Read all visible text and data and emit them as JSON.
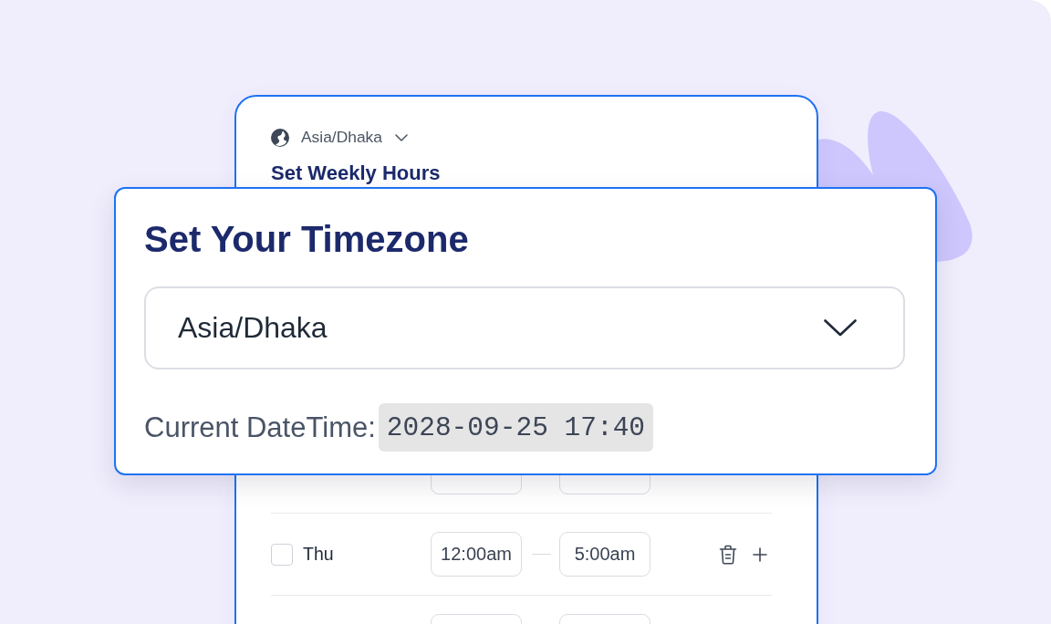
{
  "weekly_hours_card": {
    "timezone_selector": {
      "value": "Asia/Dhaka"
    },
    "heading": "Set Weekly Hours",
    "rows": [
      {},
      {
        "day": "Thu",
        "checked": false,
        "start": "12:00am",
        "end": "5:00am"
      },
      {}
    ]
  },
  "timezone_dialog": {
    "title": "Set Your Timezone",
    "timezone_select": {
      "value": "Asia/Dhaka"
    },
    "current_datetime_label": "Current DateTime:",
    "current_datetime_value": "2028-09-25 17:40"
  }
}
